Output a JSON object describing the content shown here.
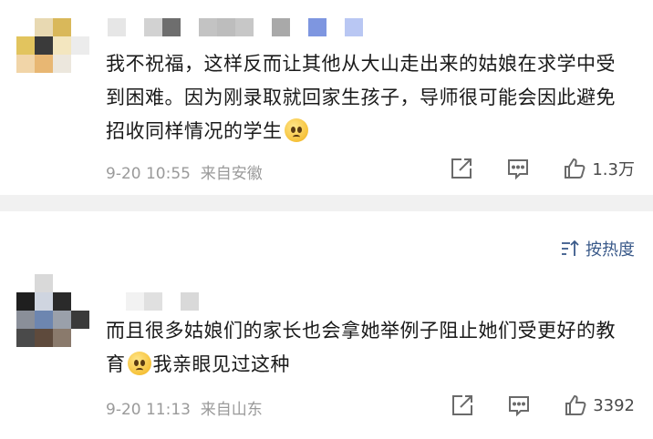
{
  "comments": [
    {
      "text_before": "我不祝福，这样反而让其他从大山走出来的姑娘在求学中受到困难。因为刚录取就回家生孩子，导师很可能会因此避免招收同样情况的学生",
      "text_after": "",
      "time": "9-20 10:55",
      "location": "来自安徽",
      "like_count": "1.3万",
      "username_colors": [
        "#e6e6e6",
        "#ffffff",
        "#d2d2d2",
        "#6e6e6e",
        "#ffffff",
        "#c3c3c3",
        "#bdbdbd",
        "#c7c7c7",
        "#ffffff",
        "#a9a9a9",
        "#ffffff",
        "#7e96e0",
        "#ffffff",
        "#b9c7f3"
      ],
      "avatar_colors": [
        "#ffffff",
        "#e8d9b2",
        "#d9b85a",
        "#ffffff",
        "#e2c45e",
        "#3a3a3a",
        "#f3e6bf",
        "#ececec",
        "#f1d5a8",
        "#e8b773",
        "#ece7dd",
        "#ffffff"
      ]
    },
    {
      "text_before": "而且很多姑娘们的家长也会拿她举例子阻止她们受更好的教育",
      "text_after": "我亲眼见过这种",
      "time": "9-20 11:13",
      "location": "来自山东",
      "like_count": "3392",
      "username_colors": [
        "#ffffff",
        "#f2f2f2",
        "#e0e0e0",
        "#ffffff",
        "#d9d9d9"
      ],
      "avatar_colors": [
        "#ffffff",
        "#d9d9d9",
        "#ffffff",
        "#ffffff",
        "#1f1f1f",
        "#cfd5e0",
        "#2a2a2a",
        "#ffffff",
        "#8a8f99",
        "#6d86b0",
        "#9aa0aa",
        "#3a3a3a",
        "#4a4a4a",
        "#5e4a3c",
        "#8a7a6c",
        "#ffffff"
      ]
    }
  ],
  "sort": {
    "label": "按热度"
  },
  "icons": {
    "share": "share-icon",
    "comment": "comment-icon",
    "like": "thumbs-up-icon",
    "sort": "sort-icon"
  },
  "colors": {
    "divider": "#f1f1f1",
    "meta_text": "#9a9a9a",
    "sort_text": "#3a5a8a"
  }
}
